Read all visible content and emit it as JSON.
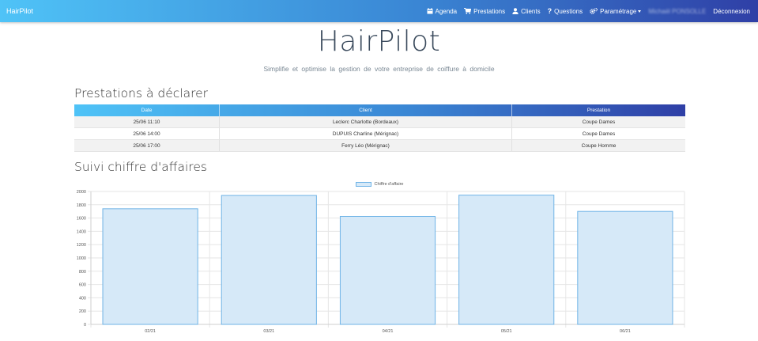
{
  "navbar": {
    "brand": "HairPilot",
    "items": [
      {
        "label": "Agenda",
        "icon": "calendar-icon"
      },
      {
        "label": "Prestations",
        "icon": "cart-icon"
      },
      {
        "label": "Clients",
        "icon": "user-icon"
      },
      {
        "label": "Questions",
        "icon": "question-icon"
      },
      {
        "label": "Paramétrage",
        "icon": "gears-icon"
      }
    ],
    "user": "Michaël PONSOLLE",
    "logout": "Déconnexion"
  },
  "header": {
    "title": "HairPilot",
    "subtitle": "Simplifie et optimise la gestion de votre entreprise de coiffure à domicile"
  },
  "prestations": {
    "title": "Prestations à déclarer",
    "columns": [
      "Date",
      "Client",
      "Prestation"
    ],
    "rows": [
      [
        "25/06 11:10",
        "Leclerc Charlotte (Bordeaux)",
        "Coupe Dames"
      ],
      [
        "25/06 14:00",
        "DUPUIS Charline (Mérignac)",
        "Coupe Dames"
      ],
      [
        "25/06 17:00",
        "Ferry Léo (Mérignac)",
        "Coupe Homme"
      ]
    ]
  },
  "suivi": {
    "title": "Suivi chiffre d'affaires"
  },
  "chart_data": {
    "type": "bar",
    "categories": [
      "02/21",
      "03/21",
      "04/21",
      "05/21",
      "06/21"
    ],
    "series": [
      {
        "name": "Chiffre d'affaire",
        "values": [
          1740,
          1940,
          1625,
          1945,
          1700
        ]
      }
    ],
    "yticks": [
      0,
      200,
      400,
      600,
      800,
      1000,
      1200,
      1400,
      1600,
      1800,
      2000
    ],
    "ylim": [
      0,
      2000
    ],
    "legend": "top",
    "grid": true,
    "colors": {
      "fill": "#d6e9f8",
      "stroke": "#6fb3e6"
    }
  }
}
